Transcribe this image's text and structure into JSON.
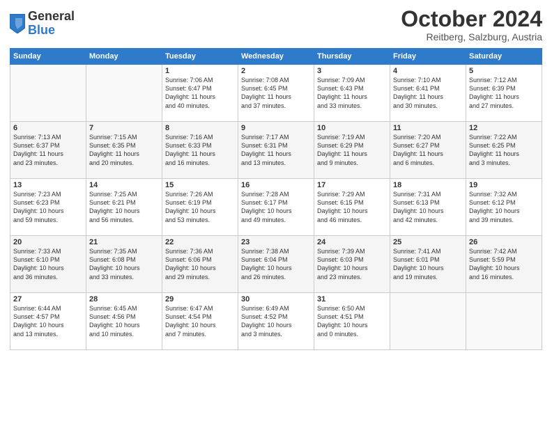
{
  "header": {
    "logo_general": "General",
    "logo_blue": "Blue",
    "month": "October 2024",
    "location": "Reitberg, Salzburg, Austria"
  },
  "weekdays": [
    "Sunday",
    "Monday",
    "Tuesday",
    "Wednesday",
    "Thursday",
    "Friday",
    "Saturday"
  ],
  "weeks": [
    [
      {
        "day": "",
        "info": ""
      },
      {
        "day": "",
        "info": ""
      },
      {
        "day": "1",
        "info": "Sunrise: 7:06 AM\nSunset: 6:47 PM\nDaylight: 11 hours\nand 40 minutes."
      },
      {
        "day": "2",
        "info": "Sunrise: 7:08 AM\nSunset: 6:45 PM\nDaylight: 11 hours\nand 37 minutes."
      },
      {
        "day": "3",
        "info": "Sunrise: 7:09 AM\nSunset: 6:43 PM\nDaylight: 11 hours\nand 33 minutes."
      },
      {
        "day": "4",
        "info": "Sunrise: 7:10 AM\nSunset: 6:41 PM\nDaylight: 11 hours\nand 30 minutes."
      },
      {
        "day": "5",
        "info": "Sunrise: 7:12 AM\nSunset: 6:39 PM\nDaylight: 11 hours\nand 27 minutes."
      }
    ],
    [
      {
        "day": "6",
        "info": "Sunrise: 7:13 AM\nSunset: 6:37 PM\nDaylight: 11 hours\nand 23 minutes."
      },
      {
        "day": "7",
        "info": "Sunrise: 7:15 AM\nSunset: 6:35 PM\nDaylight: 11 hours\nand 20 minutes."
      },
      {
        "day": "8",
        "info": "Sunrise: 7:16 AM\nSunset: 6:33 PM\nDaylight: 11 hours\nand 16 minutes."
      },
      {
        "day": "9",
        "info": "Sunrise: 7:17 AM\nSunset: 6:31 PM\nDaylight: 11 hours\nand 13 minutes."
      },
      {
        "day": "10",
        "info": "Sunrise: 7:19 AM\nSunset: 6:29 PM\nDaylight: 11 hours\nand 9 minutes."
      },
      {
        "day": "11",
        "info": "Sunrise: 7:20 AM\nSunset: 6:27 PM\nDaylight: 11 hours\nand 6 minutes."
      },
      {
        "day": "12",
        "info": "Sunrise: 7:22 AM\nSunset: 6:25 PM\nDaylight: 11 hours\nand 3 minutes."
      }
    ],
    [
      {
        "day": "13",
        "info": "Sunrise: 7:23 AM\nSunset: 6:23 PM\nDaylight: 10 hours\nand 59 minutes."
      },
      {
        "day": "14",
        "info": "Sunrise: 7:25 AM\nSunset: 6:21 PM\nDaylight: 10 hours\nand 56 minutes."
      },
      {
        "day": "15",
        "info": "Sunrise: 7:26 AM\nSunset: 6:19 PM\nDaylight: 10 hours\nand 53 minutes."
      },
      {
        "day": "16",
        "info": "Sunrise: 7:28 AM\nSunset: 6:17 PM\nDaylight: 10 hours\nand 49 minutes."
      },
      {
        "day": "17",
        "info": "Sunrise: 7:29 AM\nSunset: 6:15 PM\nDaylight: 10 hours\nand 46 minutes."
      },
      {
        "day": "18",
        "info": "Sunrise: 7:31 AM\nSunset: 6:13 PM\nDaylight: 10 hours\nand 42 minutes."
      },
      {
        "day": "19",
        "info": "Sunrise: 7:32 AM\nSunset: 6:12 PM\nDaylight: 10 hours\nand 39 minutes."
      }
    ],
    [
      {
        "day": "20",
        "info": "Sunrise: 7:33 AM\nSunset: 6:10 PM\nDaylight: 10 hours\nand 36 minutes."
      },
      {
        "day": "21",
        "info": "Sunrise: 7:35 AM\nSunset: 6:08 PM\nDaylight: 10 hours\nand 33 minutes."
      },
      {
        "day": "22",
        "info": "Sunrise: 7:36 AM\nSunset: 6:06 PM\nDaylight: 10 hours\nand 29 minutes."
      },
      {
        "day": "23",
        "info": "Sunrise: 7:38 AM\nSunset: 6:04 PM\nDaylight: 10 hours\nand 26 minutes."
      },
      {
        "day": "24",
        "info": "Sunrise: 7:39 AM\nSunset: 6:03 PM\nDaylight: 10 hours\nand 23 minutes."
      },
      {
        "day": "25",
        "info": "Sunrise: 7:41 AM\nSunset: 6:01 PM\nDaylight: 10 hours\nand 19 minutes."
      },
      {
        "day": "26",
        "info": "Sunrise: 7:42 AM\nSunset: 5:59 PM\nDaylight: 10 hours\nand 16 minutes."
      }
    ],
    [
      {
        "day": "27",
        "info": "Sunrise: 6:44 AM\nSunset: 4:57 PM\nDaylight: 10 hours\nand 13 minutes."
      },
      {
        "day": "28",
        "info": "Sunrise: 6:45 AM\nSunset: 4:56 PM\nDaylight: 10 hours\nand 10 minutes."
      },
      {
        "day": "29",
        "info": "Sunrise: 6:47 AM\nSunset: 4:54 PM\nDaylight: 10 hours\nand 7 minutes."
      },
      {
        "day": "30",
        "info": "Sunrise: 6:49 AM\nSunset: 4:52 PM\nDaylight: 10 hours\nand 3 minutes."
      },
      {
        "day": "31",
        "info": "Sunrise: 6:50 AM\nSunset: 4:51 PM\nDaylight: 10 hours\nand 0 minutes."
      },
      {
        "day": "",
        "info": ""
      },
      {
        "day": "",
        "info": ""
      }
    ]
  ]
}
